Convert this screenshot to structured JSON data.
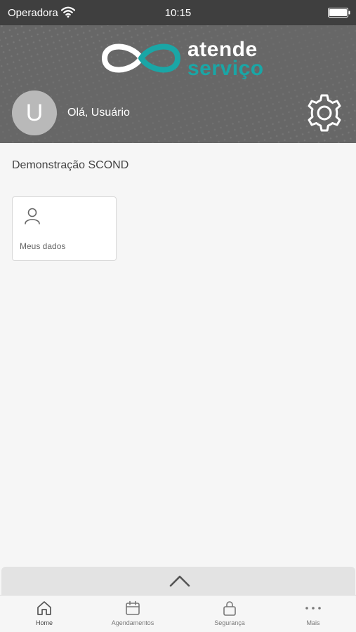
{
  "status": {
    "carrier": "Operadora",
    "time": "10:15"
  },
  "logo": {
    "word1": "atende",
    "word2": "serviço",
    "accent_color": "#1aa6a6"
  },
  "user": {
    "avatar_initial": "U",
    "greeting": "Olá, Usuário"
  },
  "section": {
    "title": "Demonstração SCOND"
  },
  "cards": [
    {
      "label": "Meus dados",
      "icon": "user-icon"
    }
  ],
  "tabs": [
    {
      "label": "Home",
      "icon": "home-icon",
      "active": true
    },
    {
      "label": "Agendamentos",
      "icon": "calendar-icon",
      "active": false
    },
    {
      "label": "Segurança",
      "icon": "lock-icon",
      "active": false
    },
    {
      "label": "Mais",
      "icon": "more-icon",
      "active": false
    }
  ]
}
